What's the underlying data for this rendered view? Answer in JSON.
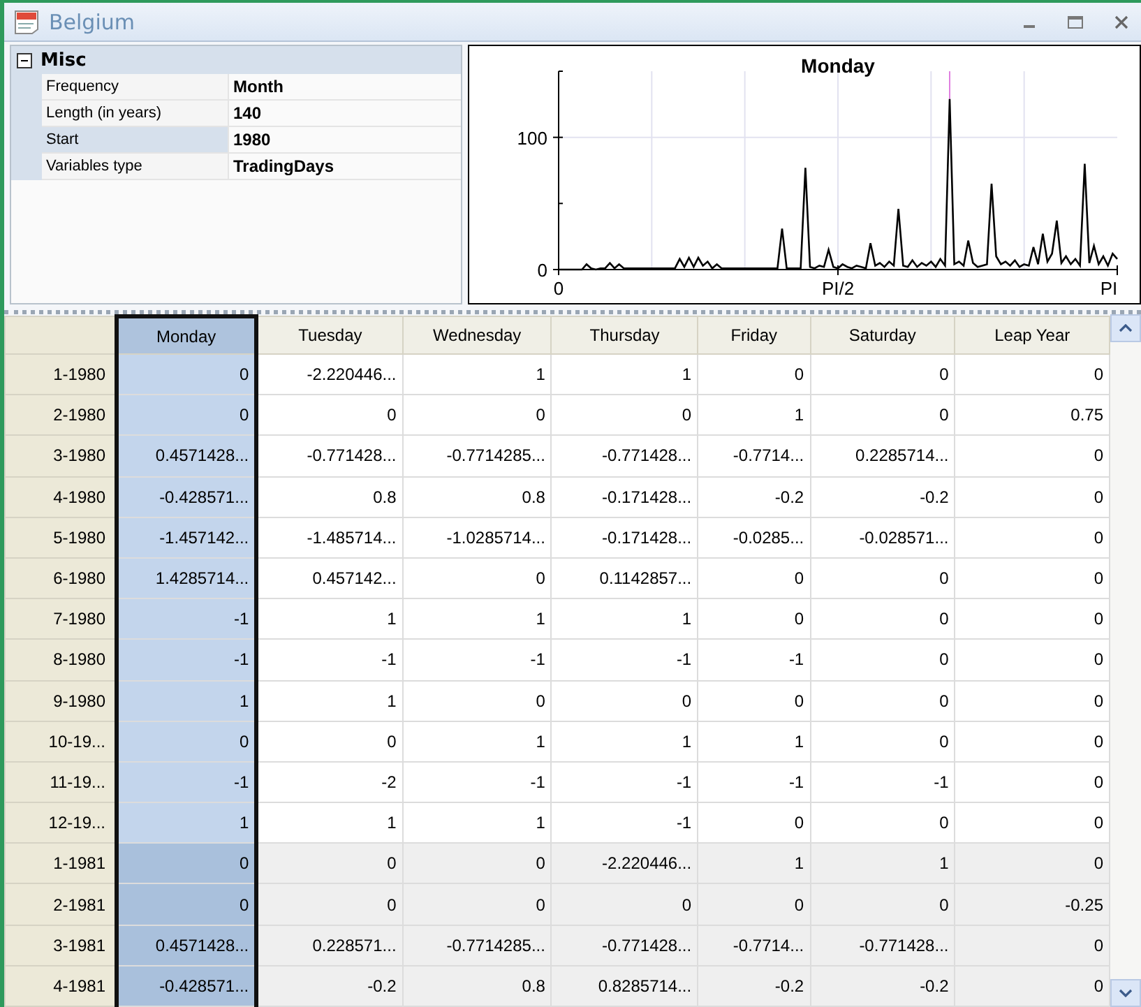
{
  "window": {
    "title": "Belgium"
  },
  "properties": {
    "category": {
      "label": "Misc",
      "expanded": true
    },
    "rows": [
      {
        "label": "Frequency",
        "value": "Month",
        "selected": false
      },
      {
        "label": "Length (in years)",
        "value": "140",
        "selected": false
      },
      {
        "label": "Start",
        "value": "1980",
        "selected": true
      },
      {
        "label": "Variables type",
        "value": "TradingDays",
        "selected": false
      }
    ]
  },
  "chart": {
    "chart_data": {
      "type": "line",
      "title": "Monday",
      "grid": true,
      "ylim": [
        0,
        150
      ],
      "yticks": [
        {
          "value": 0,
          "label": "0"
        },
        {
          "value": 100,
          "label": "100"
        }
      ],
      "categories": [
        "0",
        null,
        null,
        null,
        null,
        null,
        null,
        null,
        null,
        null,
        null,
        null,
        null,
        null,
        null,
        null,
        null,
        null,
        null,
        null,
        null,
        null,
        null,
        null,
        null,
        null,
        null,
        null,
        null,
        null,
        null,
        null,
        null,
        null,
        null,
        null,
        null,
        null,
        null,
        null,
        null,
        null,
        null,
        null,
        null,
        null,
        null,
        null,
        null,
        null,
        null,
        null,
        null,
        null,
        null,
        null,
        null,
        null,
        null,
        null,
        "PI/2",
        null,
        null,
        null,
        null,
        null,
        null,
        null,
        null,
        null,
        null,
        null,
        null,
        null,
        null,
        null,
        null,
        null,
        null,
        null,
        null,
        null,
        null,
        null,
        null,
        null,
        null,
        null,
        null,
        null,
        null,
        null,
        null,
        null,
        null,
        null,
        null,
        null,
        null,
        null,
        null,
        null,
        null,
        null,
        null,
        null,
        null,
        null,
        null,
        null,
        null,
        null,
        null,
        null,
        null,
        null,
        null,
        null,
        null,
        null,
        "PI"
      ],
      "series": [
        {
          "color": "#000000",
          "values": [
            0,
            0,
            0,
            0,
            0,
            0,
            4,
            1,
            0,
            1,
            1,
            5,
            1,
            4,
            1,
            1,
            1,
            1,
            1,
            1,
            1,
            1,
            1,
            1,
            1,
            1,
            8,
            2,
            9,
            2,
            9,
            3,
            6,
            1,
            4,
            1,
            1,
            1,
            1,
            1,
            1,
            1,
            1,
            1,
            1,
            1,
            1,
            1,
            31,
            1,
            1,
            1,
            1,
            77,
            2,
            1,
            3,
            2,
            15,
            2,
            1,
            4,
            2,
            1,
            3,
            2,
            1,
            20,
            3,
            5,
            2,
            6,
            3,
            46,
            3,
            2,
            7,
            2,
            5,
            3,
            6,
            2,
            8,
            3,
            129,
            4,
            6,
            3,
            22,
            5,
            2,
            3,
            4,
            65,
            10,
            4,
            6,
            3,
            7,
            2,
            4,
            3,
            17,
            4,
            27,
            6,
            12,
            37,
            5,
            10,
            4,
            8,
            3,
            80,
            5,
            18,
            4,
            10,
            3,
            12,
            8
          ]
        }
      ]
    }
  },
  "table": {
    "columns": [
      {
        "label": "Monday",
        "selected": true
      },
      {
        "label": "Tuesday",
        "selected": false
      },
      {
        "label": "Wednesday",
        "selected": false
      },
      {
        "label": "Thursday",
        "selected": false
      },
      {
        "label": "Friday",
        "selected": false
      },
      {
        "label": "Saturday",
        "selected": false
      },
      {
        "label": "Leap Year",
        "selected": false
      }
    ],
    "rows": [
      {
        "label": "1-1980",
        "shaded": false,
        "cells": [
          "0",
          "-2.220446...",
          "1",
          "1",
          "0",
          "0",
          "0"
        ]
      },
      {
        "label": "2-1980",
        "shaded": false,
        "cells": [
          "0",
          "0",
          "0",
          "0",
          "1",
          "0",
          "0.75"
        ]
      },
      {
        "label": "3-1980",
        "shaded": false,
        "cells": [
          "0.4571428...",
          "-0.771428...",
          "-0.7714285...",
          "-0.771428...",
          "-0.7714...",
          "0.2285714...",
          "0"
        ]
      },
      {
        "label": "4-1980",
        "shaded": false,
        "cells": [
          "-0.428571...",
          "0.8",
          "0.8",
          "-0.171428...",
          "-0.2",
          "-0.2",
          "0"
        ]
      },
      {
        "label": "5-1980",
        "shaded": false,
        "cells": [
          "-1.457142...",
          "-1.485714...",
          "-1.0285714...",
          "-0.171428...",
          "-0.0285...",
          "-0.028571...",
          "0"
        ]
      },
      {
        "label": "6-1980",
        "shaded": false,
        "cells": [
          "1.4285714...",
          "0.457142...",
          "0",
          "0.1142857...",
          "0",
          "0",
          "0"
        ]
      },
      {
        "label": "7-1980",
        "shaded": false,
        "cells": [
          "-1",
          "1",
          "1",
          "1",
          "0",
          "0",
          "0"
        ]
      },
      {
        "label": "8-1980",
        "shaded": false,
        "cells": [
          "-1",
          "-1",
          "-1",
          "-1",
          "-1",
          "0",
          "0"
        ]
      },
      {
        "label": "9-1980",
        "shaded": false,
        "cells": [
          "1",
          "1",
          "0",
          "0",
          "0",
          "0",
          "0"
        ]
      },
      {
        "label": "10-19...",
        "shaded": false,
        "cells": [
          "0",
          "0",
          "1",
          "1",
          "1",
          "0",
          "0"
        ]
      },
      {
        "label": "11-19...",
        "shaded": false,
        "cells": [
          "-1",
          "-2",
          "-1",
          "-1",
          "-1",
          "-1",
          "0"
        ]
      },
      {
        "label": "12-19...",
        "shaded": false,
        "cells": [
          "1",
          "1",
          "1",
          "-1",
          "0",
          "0",
          "0"
        ]
      },
      {
        "label": "1-1981",
        "shaded": true,
        "cells": [
          "0",
          "0",
          "0",
          "-2.220446...",
          "1",
          "1",
          "0"
        ]
      },
      {
        "label": "2-1981",
        "shaded": true,
        "cells": [
          "0",
          "0",
          "0",
          "0",
          "0",
          "0",
          "-0.25"
        ]
      },
      {
        "label": "3-1981",
        "shaded": true,
        "cells": [
          "0.4571428...",
          "0.228571...",
          "-0.7714285...",
          "-0.771428...",
          "-0.7714...",
          "-0.771428...",
          "0"
        ]
      },
      {
        "label": "4-1981",
        "shaded": true,
        "cells": [
          "-0.428571...",
          "-0.2",
          "0.8",
          "0.8285714...",
          "-0.2",
          "-0.2",
          "0"
        ]
      }
    ]
  }
}
